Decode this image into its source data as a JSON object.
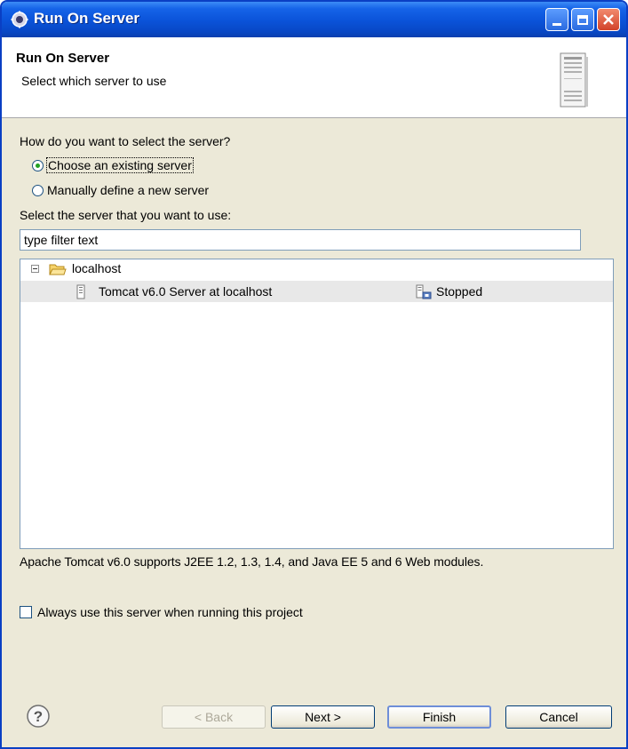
{
  "window": {
    "title": "Run On Server"
  },
  "header": {
    "title": "Run On Server",
    "subtitle": "Select which server to use"
  },
  "selection": {
    "prompt": "How do you want to select the server?",
    "options": [
      {
        "label": "Choose an existing server",
        "checked": true
      },
      {
        "label": "Manually define a new server",
        "checked": false
      }
    ],
    "select_label": "Select the server that you want to use:"
  },
  "filter": {
    "value": "type filter text"
  },
  "tree": {
    "host": "localhost",
    "server": {
      "name": "Tomcat v6.0 Server at localhost",
      "status": "Stopped"
    }
  },
  "description": "Apache Tomcat v6.0 supports J2EE 1.2, 1.3, 1.4, and Java EE 5 and 6 Web modules.",
  "always_use": {
    "label": "Always use this server when running this project",
    "checked": false
  },
  "buttons": {
    "back": "< Back",
    "next": "Next >",
    "finish": "Finish",
    "cancel": "Cancel"
  },
  "icons": {
    "title": "eclipse-gear-icon",
    "header": "server-icon",
    "folder": "folder-open-icon",
    "server": "server-small-icon",
    "status": "server-stopped-icon",
    "help": "help-icon"
  }
}
